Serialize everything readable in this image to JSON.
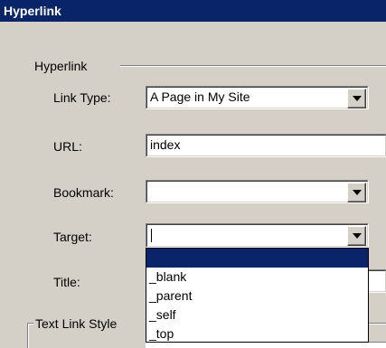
{
  "window": {
    "title": "Hyperlink"
  },
  "group": {
    "label": "Hyperlink"
  },
  "fields": {
    "link_type": {
      "label": "Link Type:",
      "value": "A Page in My Site"
    },
    "url": {
      "label": "URL:",
      "value": "index"
    },
    "bookmark": {
      "label": "Bookmark:",
      "value": ""
    },
    "target": {
      "label": "Target:",
      "value": "",
      "options": [
        "",
        "_blank",
        "_parent",
        "_self",
        "_top"
      ],
      "selected_index": 0
    },
    "title": {
      "label": "Title:"
    }
  },
  "text_link_style": {
    "label": "Text Link Style"
  },
  "colors": {
    "titlebar": "#0a246a",
    "dialog_bg": "#d4d0c8",
    "selection": "#0a246a"
  },
  "icons": {
    "dropdown": "chevron-down-icon"
  }
}
